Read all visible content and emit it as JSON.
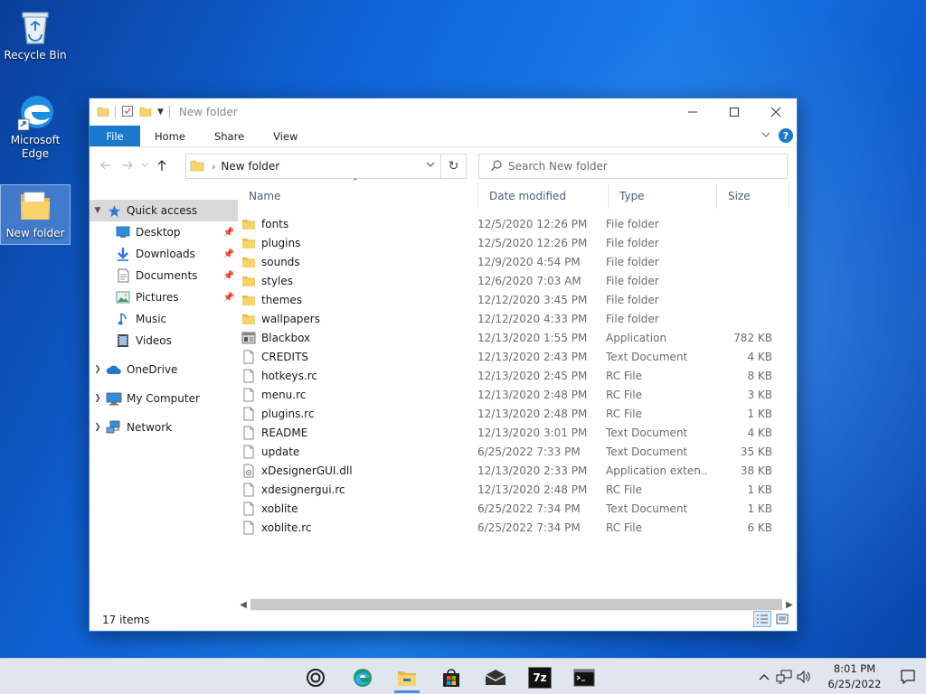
{
  "desktop": {
    "icons": [
      {
        "label": "Recycle Bin",
        "icon": "recycle-bin-icon"
      },
      {
        "label": "Microsoft Edge",
        "icon": "edge-icon"
      },
      {
        "label": "New folder",
        "icon": "folder-icon"
      }
    ]
  },
  "window": {
    "title": "New folder",
    "ribbon_tabs": [
      "File",
      "Home",
      "Share",
      "View"
    ],
    "address": {
      "path": "New folder"
    },
    "search": {
      "placeholder": "Search New folder"
    },
    "sidebar": {
      "quick_access": "Quick access",
      "quick_items": [
        {
          "label": "Desktop",
          "icon": "desktop-icon",
          "pinned": true
        },
        {
          "label": "Downloads",
          "icon": "downloads-icon",
          "pinned": true
        },
        {
          "label": "Documents",
          "icon": "documents-icon",
          "pinned": true
        },
        {
          "label": "Pictures",
          "icon": "pictures-icon",
          "pinned": true
        },
        {
          "label": "Music",
          "icon": "music-icon",
          "pinned": false
        },
        {
          "label": "Videos",
          "icon": "videos-icon",
          "pinned": false
        }
      ],
      "onedrive": "OneDrive",
      "my_computer": "My Computer",
      "network": "Network"
    },
    "columns": {
      "name": "Name",
      "date": "Date modified",
      "type": "Type",
      "size": "Size"
    },
    "files": [
      {
        "name": "fonts",
        "date": "12/5/2020 12:26 PM",
        "type": "File folder",
        "size": "",
        "icon": "folder"
      },
      {
        "name": "plugins",
        "date": "12/5/2020 12:26 PM",
        "type": "File folder",
        "size": "",
        "icon": "folder"
      },
      {
        "name": "sounds",
        "date": "12/9/2020 4:54 PM",
        "type": "File folder",
        "size": "",
        "icon": "folder"
      },
      {
        "name": "styles",
        "date": "12/6/2020 7:03 AM",
        "type": "File folder",
        "size": "",
        "icon": "folder"
      },
      {
        "name": "themes",
        "date": "12/12/2020 3:45 PM",
        "type": "File folder",
        "size": "",
        "icon": "folder"
      },
      {
        "name": "wallpapers",
        "date": "12/12/2020 4:33 PM",
        "type": "File folder",
        "size": "",
        "icon": "folder"
      },
      {
        "name": "Blackbox",
        "date": "12/13/2020 1:55 PM",
        "type": "Application",
        "size": "782 KB",
        "icon": "app"
      },
      {
        "name": "CREDITS",
        "date": "12/13/2020 2:43 PM",
        "type": "Text Document",
        "size": "4 KB",
        "icon": "doc"
      },
      {
        "name": "hotkeys.rc",
        "date": "12/13/2020 2:45 PM",
        "type": "RC File",
        "size": "8 KB",
        "icon": "doc"
      },
      {
        "name": "menu.rc",
        "date": "12/13/2020 2:48 PM",
        "type": "RC File",
        "size": "3 KB",
        "icon": "doc"
      },
      {
        "name": "plugins.rc",
        "date": "12/13/2020 2:48 PM",
        "type": "RC File",
        "size": "1 KB",
        "icon": "doc"
      },
      {
        "name": "README",
        "date": "12/13/2020 3:01 PM",
        "type": "Text Document",
        "size": "4 KB",
        "icon": "doc"
      },
      {
        "name": "update",
        "date": "6/25/2022 7:33 PM",
        "type": "Text Document",
        "size": "35 KB",
        "icon": "doc"
      },
      {
        "name": "xDesignerGUI.dll",
        "date": "12/13/2020 2:33 PM",
        "type": "Application exten...",
        "size": "38 KB",
        "icon": "dll"
      },
      {
        "name": "xdesignergui.rc",
        "date": "12/13/2020 2:48 PM",
        "type": "RC File",
        "size": "1 KB",
        "icon": "doc"
      },
      {
        "name": "xoblite",
        "date": "6/25/2022 7:34 PM",
        "type": "Text Document",
        "size": "1 KB",
        "icon": "doc"
      },
      {
        "name": "xoblite.rc",
        "date": "6/25/2022 7:34 PM",
        "type": "RC File",
        "size": "6 KB",
        "icon": "doc"
      }
    ],
    "status": "17 items"
  },
  "taskbar": {
    "apps": [
      "cortana-icon",
      "edge-icon",
      "file-explorer-icon",
      "store-icon",
      "mail-icon",
      "7zip-icon",
      "terminal-icon"
    ],
    "seven_zip_label": "7z",
    "clock": {
      "time": "8:01 PM",
      "date": "6/25/2022"
    }
  },
  "colors": {
    "accent": "#1979ca",
    "folder": "#f7d46b"
  }
}
